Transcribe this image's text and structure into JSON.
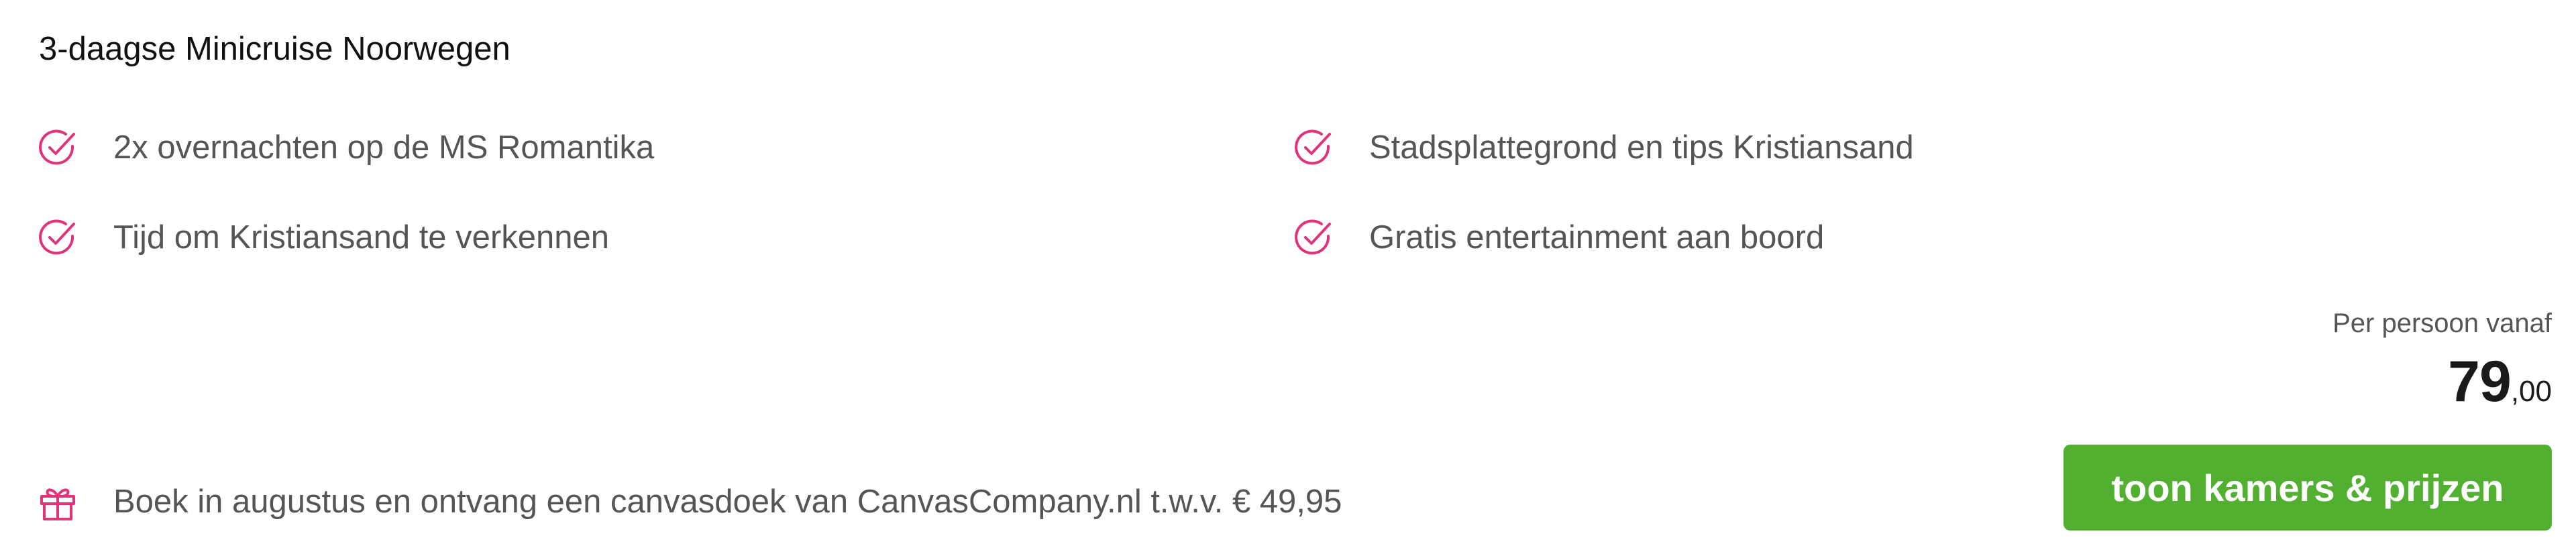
{
  "trip": {
    "title": "3-daagse Minicruise Noorwegen"
  },
  "features": [
    {
      "icon": "check-circle-icon",
      "label": "2x overnachten op de MS Romantika"
    },
    {
      "icon": "check-circle-icon",
      "label": "Stadsplattegrond en tips Kristiansand"
    },
    {
      "icon": "check-circle-icon",
      "label": "Tijd om Kristiansand te verkennen"
    },
    {
      "icon": "check-circle-icon",
      "label": "Gratis entertainment aan boord"
    }
  ],
  "promo": {
    "icon": "gift-icon",
    "text": "Boek in augustus en ontvang een canvasdoek van CanvasCompany.nl t.w.v. € 49,95"
  },
  "pricing": {
    "per_person_label": "Per persoon vanaf",
    "price_euros": "79",
    "price_cents": ",00"
  },
  "cta": {
    "label": "toon kamers & prijzen"
  },
  "colors": {
    "accent_pink": "#e0337a",
    "button_green": "#52b031",
    "text_dark": "#111111",
    "text_muted": "#555555"
  }
}
